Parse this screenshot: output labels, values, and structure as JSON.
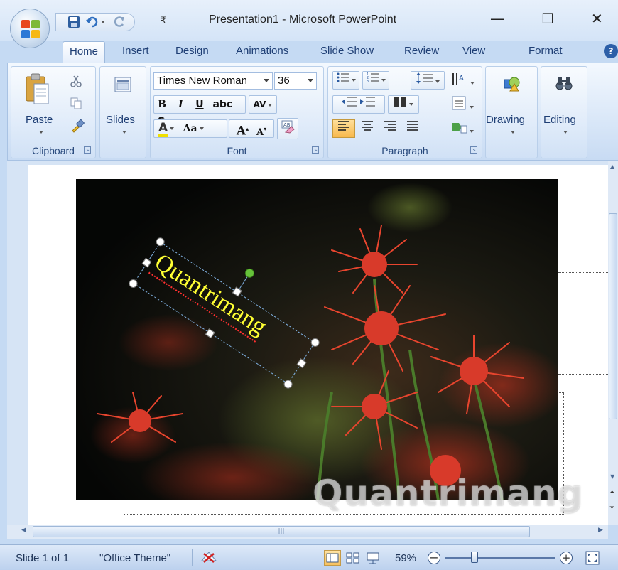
{
  "window": {
    "title": "Presentation1 - Microsoft PowerPoint",
    "controls": [
      "—",
      "☐",
      "✕"
    ]
  },
  "quick_access": {
    "more": "₹"
  },
  "tabs": [
    "Home",
    "Insert",
    "Design",
    "Animations",
    "Slide Show",
    "Review",
    "View",
    "Format"
  ],
  "help": "?",
  "ribbon": {
    "clipboard": {
      "label": "Clipboard",
      "paste": "Paste"
    },
    "slides": {
      "label": "Slides",
      "button": "Slides"
    },
    "font": {
      "label": "Font",
      "family": "Times New Roman",
      "size": "36",
      "bold": "B",
      "italic": "I",
      "underline": "U",
      "strike": "abc",
      "shadow": "S",
      "spacing": "AV",
      "color": "A",
      "case": "Aa",
      "grow": "A",
      "shrink": "A"
    },
    "paragraph": {
      "label": "Paragraph"
    },
    "drawing": {
      "label": "Drawing"
    },
    "editing": {
      "label": "Editing"
    }
  },
  "slide": {
    "textbox_text": "Quantrimang",
    "watermark": "Quantrimang"
  },
  "status": {
    "slide": "Slide 1 of 1",
    "theme": "\"Office Theme\"",
    "zoom": "59%",
    "zoom_level": 0.59
  },
  "colors": {
    "accent": "#2c5fa8",
    "textbox_text": "#ffff33",
    "flower": "#d83a2a"
  }
}
